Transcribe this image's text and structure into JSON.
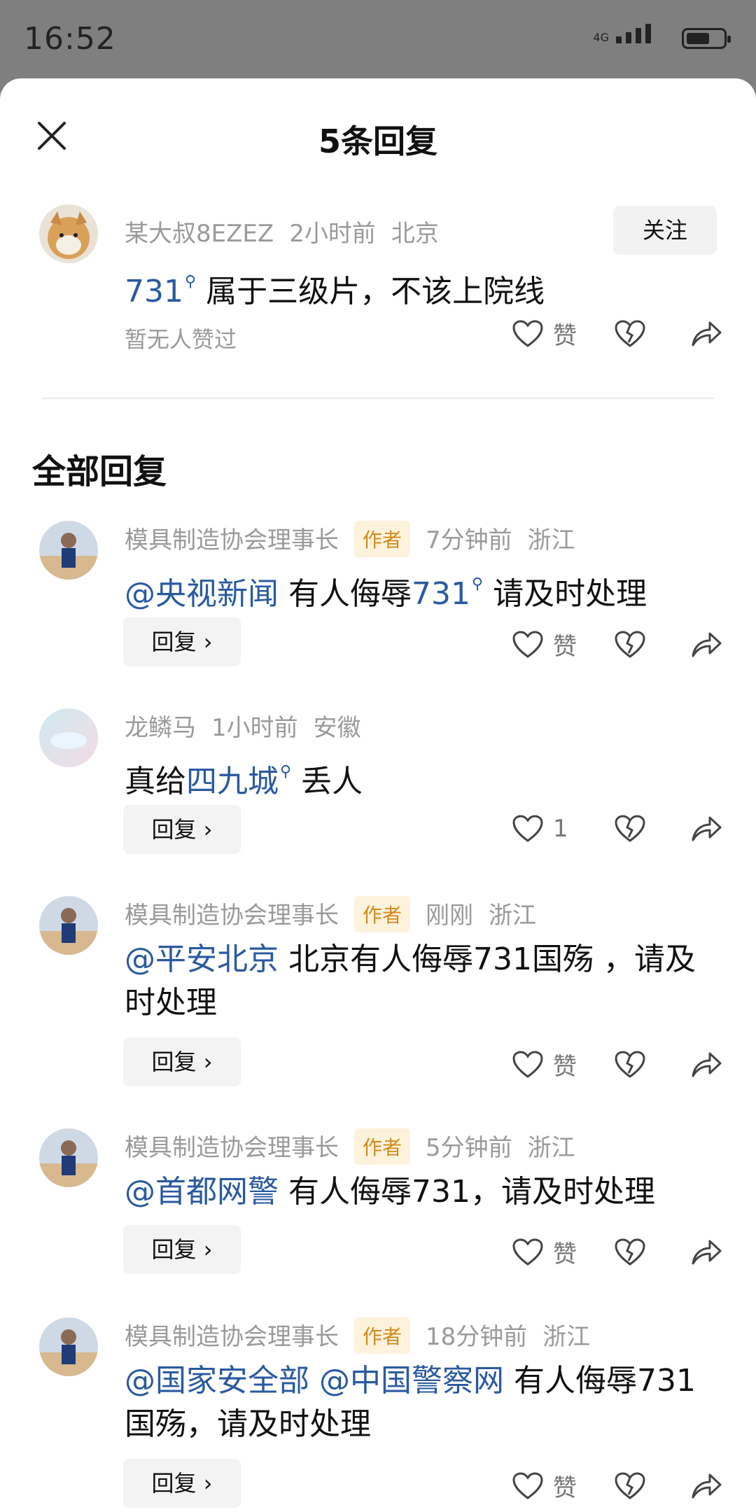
{
  "status_bar": {
    "time": "16:52",
    "network": "4G"
  },
  "header": {
    "title": "5条回复"
  },
  "main_comment": {
    "username": "某大叔8EZEZ",
    "time": "2小时前",
    "location": "北京",
    "follow_label": "关注",
    "content_link": "731",
    "content_text": " 属于三级片，不该上院线",
    "no_likes": "暂无人赞过",
    "like_label": "赞"
  },
  "section_title": "全部回复",
  "replies": [
    {
      "username": "模具制造协会理事长",
      "author_tag": "作者",
      "time": "7分钟前",
      "location": "浙江",
      "mention": "@央视新闻",
      "text_a": " 有人侮辱",
      "link": "731",
      "text_b": "  请及时处理",
      "reply_label": "回复",
      "like_label": "赞"
    },
    {
      "username": "龙鳞马",
      "time": "1小时前",
      "location": "安徽",
      "text_a": "真给",
      "link": "四九城",
      "text_b": " 丢人",
      "reply_label": "回复",
      "like_label": "1"
    },
    {
      "username": "模具制造协会理事长",
      "author_tag": "作者",
      "time": "刚刚",
      "location": "浙江",
      "mention": "@平安北京",
      "text_a": " 北京有人侮辱731国殇 ，请及时处理",
      "reply_label": "回复",
      "like_label": "赞"
    },
    {
      "username": "模具制造协会理事长",
      "author_tag": "作者",
      "time": "5分钟前",
      "location": "浙江",
      "mention": "@首都网警",
      "text_a": " 有人侮辱731，请及时处理",
      "reply_label": "回复",
      "like_label": "赞"
    },
    {
      "username": "模具制造协会理事长",
      "author_tag": "作者",
      "time": "18分钟前",
      "location": "浙江",
      "mention": "@国家安全部",
      "mention2": " @中国警察网",
      "text_a": " 有人侮辱731国殇，请及时处理",
      "reply_label": "回复",
      "like_label": "赞"
    }
  ]
}
